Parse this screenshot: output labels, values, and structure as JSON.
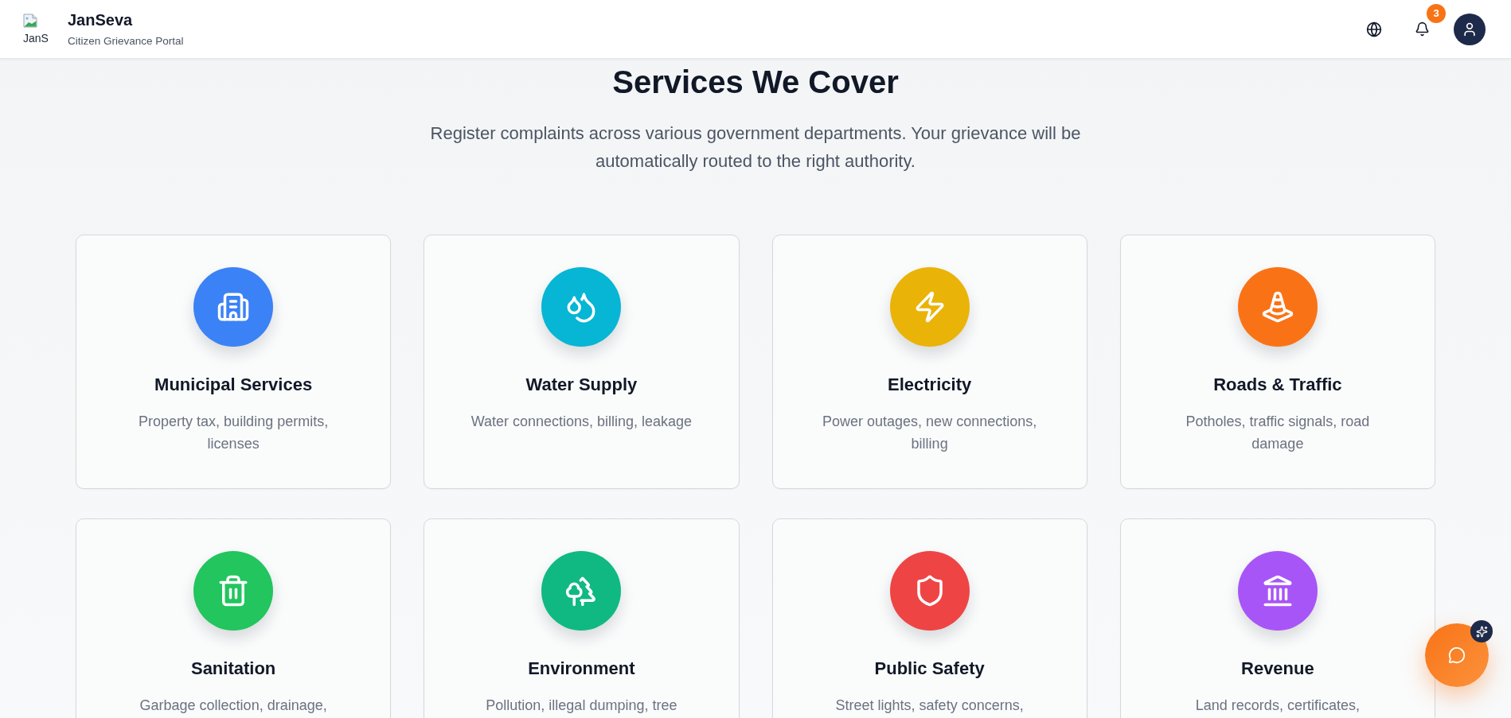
{
  "header": {
    "logo_alt": "JanS",
    "title": "JanSeva",
    "subtitle": "Citizen Grievance Portal",
    "notification_count": "3"
  },
  "section": {
    "title": "Services We Cover",
    "subtitle": "Register complaints across various government departments. Your grievance will be automatically routed to the right authority."
  },
  "services": [
    {
      "name": "Municipal Services",
      "description": "Property tax, building permits, licenses",
      "color": "#3b82f6"
    },
    {
      "name": "Water Supply",
      "description": "Water connections, billing, leakage",
      "color": "#06b6d4"
    },
    {
      "name": "Electricity",
      "description": "Power outages, new connections, billing",
      "color": "#eab308"
    },
    {
      "name": "Roads & Traffic",
      "description": "Potholes, traffic signals, road damage",
      "color": "#f97316"
    },
    {
      "name": "Sanitation",
      "description": "Garbage collection, drainage,",
      "color": "#22c55e"
    },
    {
      "name": "Environment",
      "description": "Pollution, illegal dumping, tree",
      "color": "#10b981"
    },
    {
      "name": "Public Safety",
      "description": "Street lights, safety concerns,",
      "color": "#ef4444"
    },
    {
      "name": "Revenue",
      "description": "Land records, certificates,",
      "color": "#a855f7"
    }
  ]
}
